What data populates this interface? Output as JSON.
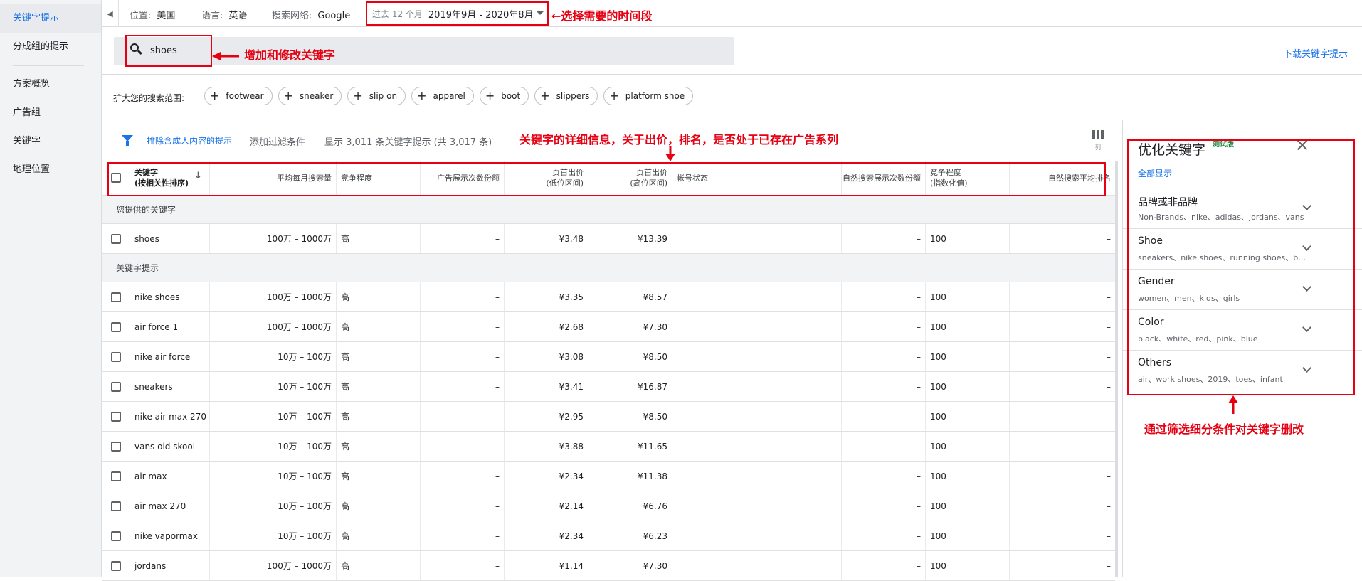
{
  "sidebar": {
    "items": [
      {
        "label": "关键字提示"
      },
      {
        "label": "分成组的提示"
      },
      {
        "label": "方案概览"
      },
      {
        "label": "广告组"
      },
      {
        "label": "关键字"
      },
      {
        "label": "地理位置"
      }
    ]
  },
  "topbar": {
    "location_label": "位置:",
    "location_value": "美国",
    "language_label": "语言:",
    "language_value": "英语",
    "network_label": "搜索网络:",
    "network_value": "Google",
    "period_label": "过去 12 个月",
    "period_value": "2019年9月 - 2020年8月"
  },
  "search": {
    "value": "shoes",
    "download_label": "下载关键字提示"
  },
  "broaden": {
    "label": "扩大您的搜索范围:",
    "chips": [
      "footwear",
      "sneaker",
      "slip on",
      "apparel",
      "boot",
      "slippers",
      "platform shoe"
    ]
  },
  "filters": {
    "adult_filter_label": "排除含成人内容的提示",
    "add_filter_label": "添加过滤条件",
    "count_text": "显示 3,011 条关键字提示 (共 3,017 条)",
    "columns_label": "列"
  },
  "table": {
    "headers": {
      "keyword_line1": "关键字",
      "keyword_line2": "(按相关性排序)",
      "avg_searches": "平均每月搜索量",
      "competition": "竞争程度",
      "impression_share": "广告展示次数份额",
      "bid_low_line1": "页首出价",
      "bid_low_line2": "(低位区间)",
      "bid_high_line1": "页首出价",
      "bid_high_line2": "(高位区间)",
      "account_status": "帐号状态",
      "organic_impression": "自然搜索展示次数份额",
      "comp_index_line1": "竞争程度",
      "comp_index_line2": "(指数化值)",
      "organic_rank": "自然搜索平均排名"
    },
    "provided_group_label": "您提供的关键字",
    "provided": [
      {
        "keyword": "shoes",
        "searches": "100万 – 1000万",
        "competition": "高",
        "share": "–",
        "bid_low": "¥3.48",
        "bid_high": "¥13.39",
        "status": "",
        "organic": "–",
        "index": "100",
        "rank": "–"
      }
    ],
    "ideas_group_label": "关键字提示",
    "ideas": [
      {
        "keyword": "nike shoes",
        "searches": "100万 – 1000万",
        "competition": "高",
        "share": "–",
        "bid_low": "¥3.35",
        "bid_high": "¥8.57",
        "status": "",
        "organic": "–",
        "index": "100",
        "rank": "–"
      },
      {
        "keyword": "air force 1",
        "searches": "100万 – 1000万",
        "competition": "高",
        "share": "–",
        "bid_low": "¥2.68",
        "bid_high": "¥7.30",
        "status": "",
        "organic": "–",
        "index": "100",
        "rank": "–"
      },
      {
        "keyword": "nike air force",
        "searches": "10万 – 100万",
        "competition": "高",
        "share": "–",
        "bid_low": "¥3.08",
        "bid_high": "¥8.50",
        "status": "",
        "organic": "–",
        "index": "100",
        "rank": "–"
      },
      {
        "keyword": "sneakers",
        "searches": "10万 – 100万",
        "competition": "高",
        "share": "–",
        "bid_low": "¥3.41",
        "bid_high": "¥16.87",
        "status": "",
        "organic": "–",
        "index": "100",
        "rank": "–"
      },
      {
        "keyword": "nike air max 270",
        "searches": "10万 – 100万",
        "competition": "高",
        "share": "–",
        "bid_low": "¥2.95",
        "bid_high": "¥8.50",
        "status": "",
        "organic": "–",
        "index": "100",
        "rank": "–"
      },
      {
        "keyword": "vans old skool",
        "searches": "10万 – 100万",
        "competition": "高",
        "share": "–",
        "bid_low": "¥3.88",
        "bid_high": "¥11.65",
        "status": "",
        "organic": "–",
        "index": "100",
        "rank": "–"
      },
      {
        "keyword": "air max",
        "searches": "10万 – 100万",
        "competition": "高",
        "share": "–",
        "bid_low": "¥2.34",
        "bid_high": "¥11.38",
        "status": "",
        "organic": "–",
        "index": "100",
        "rank": "–"
      },
      {
        "keyword": "air max 270",
        "searches": "10万 – 100万",
        "competition": "高",
        "share": "–",
        "bid_low": "¥2.14",
        "bid_high": "¥6.76",
        "status": "",
        "organic": "–",
        "index": "100",
        "rank": "–"
      },
      {
        "keyword": "nike vapormax",
        "searches": "10万 – 100万",
        "competition": "高",
        "share": "–",
        "bid_low": "¥2.34",
        "bid_high": "¥6.23",
        "status": "",
        "organic": "–",
        "index": "100",
        "rank": "–"
      },
      {
        "keyword": "jordans",
        "searches": "100万 – 1000万",
        "competition": "高",
        "share": "–",
        "bid_low": "¥1.14",
        "bid_high": "¥7.30",
        "status": "",
        "organic": "–",
        "index": "100",
        "rank": "–"
      }
    ]
  },
  "refine": {
    "title": "优化关键字",
    "beta": "测试版",
    "show_all": "全部显示",
    "items": [
      {
        "name": "品牌或非品牌",
        "subs": "Non-Brands、nike、adidas、jordans、vans"
      },
      {
        "name": "Shoe",
        "subs": "sneakers、nike shoes、running shoes、boots、heels"
      },
      {
        "name": "Gender",
        "subs": "women、men、kids、girls"
      },
      {
        "name": "Color",
        "subs": "black、white、red、pink、blue"
      },
      {
        "name": "Others",
        "subs": "air、work shoes、2019、toes、infant"
      }
    ]
  },
  "annotations": {
    "time_note": "←选择需要的时间段",
    "search_note": "增加和修改关键字",
    "detail_note": "关键字的详细信息，关于出价，排名，是否处于已存在广告系列",
    "refine_note": "通过筛选细分条件对关键字删改"
  }
}
